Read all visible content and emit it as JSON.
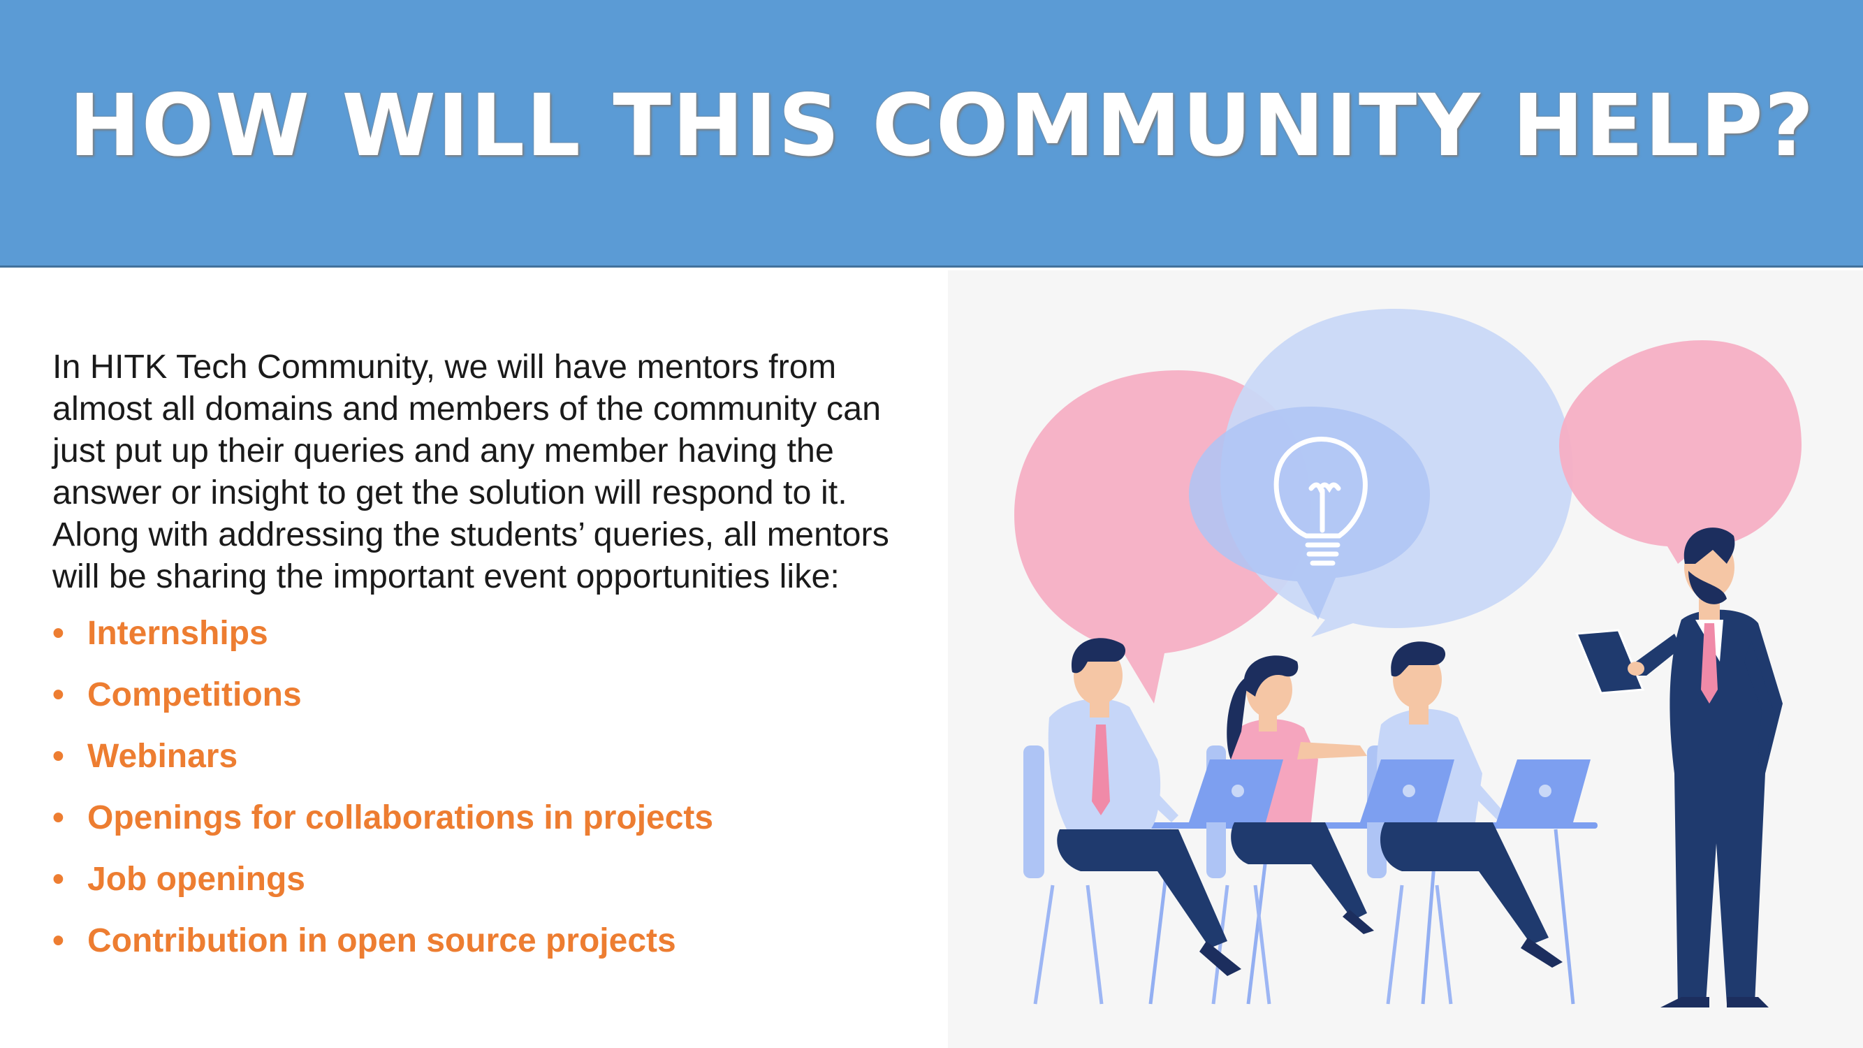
{
  "slide": {
    "title": "HOW WILL THIS COMMUNITY HELP?",
    "intro": "In HITK Tech Community, we will have mentors from almost all domains and members of the community can just put up their queries and any member having the answer or insight to get the solution will respond to it. Along with addressing the students’ queries, all mentors will be sharing the important event opportunities like:",
    "bullet_symbol": "•",
    "bullets": [
      "Internships",
      "Competitions",
      "Webinars",
      "Openings for collaborations in projects",
      "Job openings",
      "Contribution in open source projects"
    ]
  },
  "colors": {
    "header": "#5b9bd5",
    "bullet_text": "#ed7d31",
    "body_text": "#1a1a1a",
    "illustration_bg": "#f6f6f6"
  },
  "illustration": {
    "icon": "lightbulb-icon",
    "subject": "team-meeting-illustration"
  }
}
